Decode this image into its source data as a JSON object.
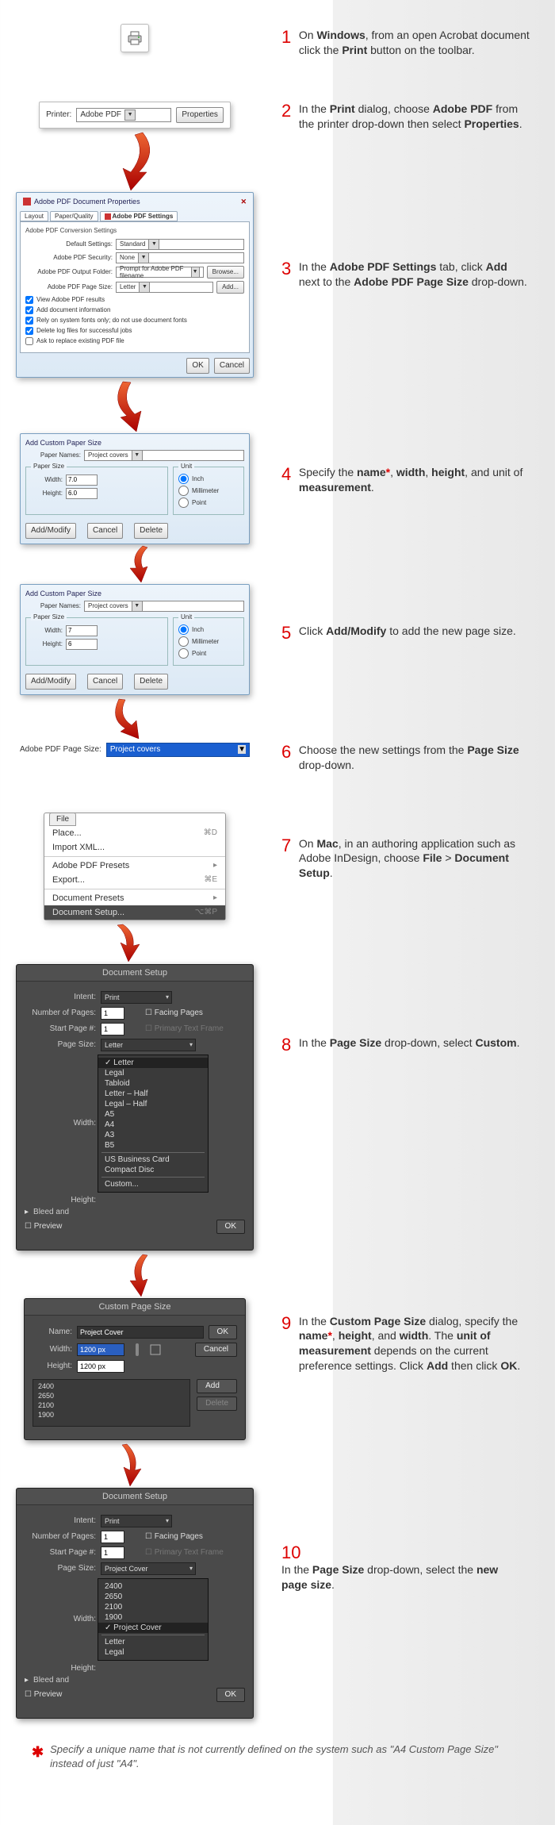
{
  "steps": [
    {
      "num": "1",
      "html": "On <b>Windows</b>, from an open Acrobat document click the <b>Print</b> button on the toolbar."
    },
    {
      "num": "2",
      "html": "In the <b>Print</b> dialog, choose <b>Adobe PDF</b> from the printer drop-down then select <b>Properties</b>."
    },
    {
      "num": "3",
      "html": "In the <b>Adobe PDF Settings</b> tab, click <b>Add</b> next to the <b>Adobe PDF Page Size</b> drop-down."
    },
    {
      "num": "4",
      "html": "Specify the <b>name<span class=\"asterisk\">*</span></b>, <b>width</b>, <b>height</b>, and unit of <b>measurement</b>."
    },
    {
      "num": "5",
      "html": "Click <b>Add/Modify</b> to add the new page size."
    },
    {
      "num": "6",
      "html": "Choose the new settings from the <b>Page Size</b> drop-down."
    },
    {
      "num": "7",
      "html": " On <b>Mac</b>, in an authoring application such as Adobe InDesign, choose <b>File</b> > <b>Document Setup</b>."
    },
    {
      "num": "8",
      "html": " In the <b>Page Size</b> drop-down, select <b>Custom</b>."
    },
    {
      "num": "9",
      "html": "In the <b>Custom Page Size</b> dialog, specify the <b>name<span class=\"asterisk\">*</span></b>, <b>height</b>, and <b>width</b>. The <b>unit of measurement</b> depends on the current preference settings. Click <b>Add</b> then click <b>OK</b>."
    },
    {
      "num": "10",
      "html": "In the <b>Page Size</b> drop-down, select the <b>new page size</b>."
    }
  ],
  "printDialog": {
    "printerLabel": "Printer:",
    "printerValue": "Adobe PDF",
    "propertiesBtn": "Properties"
  },
  "pdfProps": {
    "title": "Adobe PDF Document Properties",
    "tabs": [
      "Layout",
      "Paper/Quality",
      "Adobe PDF Settings"
    ],
    "sectionTitle": "Adobe PDF Conversion Settings",
    "rows": {
      "defaultSettingsLabel": "Default Settings:",
      "defaultSettingsValue": "Standard",
      "securityLabel": "Adobe PDF Security:",
      "securityValue": "None",
      "outputLabel": "Adobe PDF Output Folder:",
      "outputValue": "Prompt for Adobe PDF filename",
      "browseBtn": "Browse...",
      "pageSizeLabel": "Adobe PDF Page Size:",
      "pageSizeValue": "Letter",
      "addBtn": "Add..."
    },
    "checks": [
      {
        "checked": true,
        "label": "View Adobe PDF results"
      },
      {
        "checked": true,
        "label": "Add document information"
      },
      {
        "checked": true,
        "label": "Rely on system fonts only; do not use document fonts"
      },
      {
        "checked": true,
        "label": "Delete log files for successful jobs"
      },
      {
        "checked": false,
        "label": "Ask to replace existing PDF file"
      }
    ],
    "okBtn": "OK",
    "cancelBtn": "Cancel"
  },
  "paperDlg1": {
    "title": "Add Custom Paper Size",
    "paperNamesLabel": "Paper Names:",
    "paperNamesValue": "Project covers",
    "paperSizeLegend": "Paper Size",
    "widthLabel": "Width:",
    "widthValue": "7.0",
    "heightLabel": "Height:",
    "heightValue": "6.0",
    "unitLegend": "Unit",
    "units": [
      "Inch",
      "Millimeter",
      "Point"
    ],
    "unitSelected": 0,
    "addModifyBtn": "Add/Modify",
    "cancelBtn": "Cancel",
    "deleteBtn": "Delete"
  },
  "paperDlg2": {
    "title": "Add Custom Paper Size",
    "paperNamesLabel": "Paper Names:",
    "paperNamesValue": "Project covers",
    "paperSizeLegend": "Paper Size",
    "widthLabel": "Width:",
    "widthValue": "7",
    "heightLabel": "Height:",
    "heightValue": "6",
    "unitLegend": "Unit",
    "units": [
      "Inch",
      "Millimeter",
      "Point"
    ],
    "unitSelected": 0,
    "addModifyBtn": "Add/Modify",
    "cancelBtn": "Cancel",
    "deleteBtn": "Delete"
  },
  "pageSizeLine": {
    "label": "Adobe PDF Page Size:",
    "value": "Project covers"
  },
  "macMenu": {
    "fileLabel": "File",
    "items": [
      {
        "label": "Place...",
        "shortcut": "⌘D"
      },
      {
        "label": "Import XML..."
      },
      {
        "divider": true
      },
      {
        "label": "Adobe PDF Presets",
        "sub": true
      },
      {
        "label": "Export...",
        "shortcut": "⌘E"
      },
      {
        "divider": true
      },
      {
        "label": "Document Presets",
        "sub": true
      },
      {
        "label": "Document Setup...",
        "shortcut": "⌥⌘P",
        "highlight": true
      }
    ]
  },
  "docSetup1": {
    "title": "Document Setup",
    "intentLabel": "Intent:",
    "intentValue": "Print",
    "numPagesLabel": "Number of Pages:",
    "numPagesValue": "1",
    "facingPages": "Facing Pages",
    "startPageLabel": "Start Page #:",
    "startPageValue": "1",
    "primaryText": "Primary Text Frame",
    "pageSizeLabel": "Page Size:",
    "pageSizeValue": "Letter",
    "widthLabel": "Width:",
    "heightLabel": "Height:",
    "bleedLabel": "Bleed and",
    "preview": "Preview",
    "okBtn": "OK",
    "dropdown": [
      "Letter",
      "Legal",
      "Tabloid",
      "Letter – Half",
      "Legal – Half",
      "A5",
      "A4",
      "A3",
      "B5",
      "",
      "US Business Card",
      "Compact Disc",
      "",
      "Custom..."
    ]
  },
  "customPage": {
    "title": "Custom Page Size",
    "nameLabel": "Name:",
    "nameValue": "Project Cover",
    "widthLabel": "Width:",
    "widthValue": "1200 px",
    "heightLabel": "Height:",
    "heightValue": "1200 px",
    "okBtn": "OK",
    "cancelBtn": "Cancel",
    "addBtn": "Add",
    "deleteBtn": "Delete",
    "sizes": [
      "2400",
      "2650",
      "2100",
      "1900"
    ]
  },
  "docSetup2": {
    "title": "Document Setup",
    "intentLabel": "Intent:",
    "intentValue": "Print",
    "numPagesLabel": "Number of Pages:",
    "numPagesValue": "1",
    "facingPages": "Facing Pages",
    "startPageLabel": "Start Page #:",
    "startPageValue": "1",
    "primaryText": "Primary Text Frame",
    "pageSizeLabel": "Page Size:",
    "pageSizeValue": "Project Cover",
    "widthLabel": "Width:",
    "heightLabel": "Height:",
    "bleedLabel": "Bleed and",
    "preview": "Preview",
    "okBtn": "OK",
    "dropdown": [
      "2400",
      "2650",
      "2100",
      "1900",
      "Project Cover",
      "",
      "Letter",
      "Legal"
    ]
  },
  "footnote": "Specify a unique name that is not currently defined on the system such as \"A4 Custom Page Size\" instead of just \"A4\"."
}
